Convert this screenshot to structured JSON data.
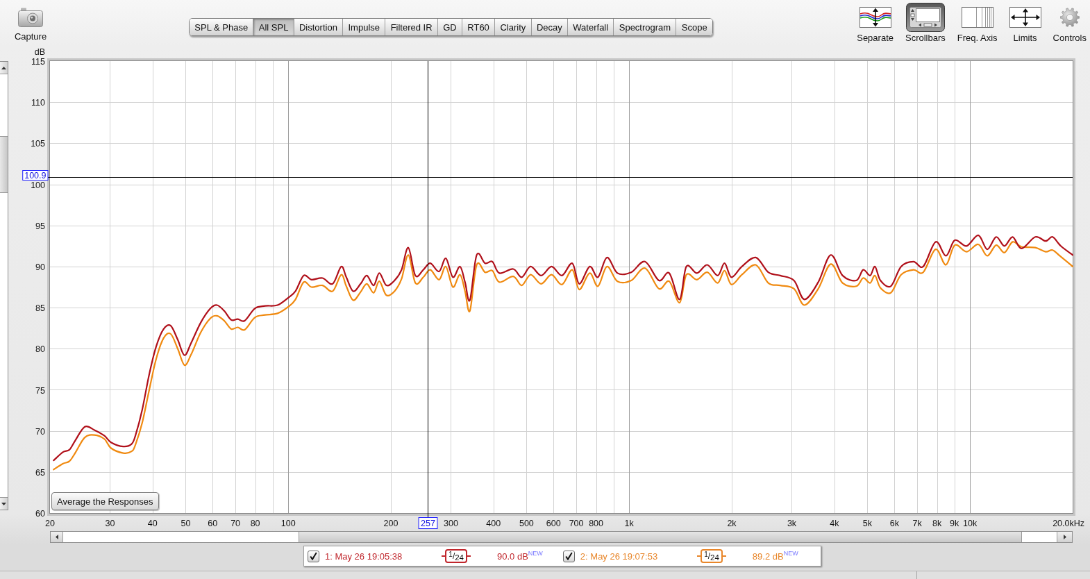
{
  "toolbar": {
    "capture": {
      "label": "Capture"
    },
    "tabs": [
      {
        "label": "SPL & Phase",
        "selected": false
      },
      {
        "label": "All SPL",
        "selected": true
      },
      {
        "label": "Distortion",
        "selected": false
      },
      {
        "label": "Impulse",
        "selected": false
      },
      {
        "label": "Filtered IR",
        "selected": false
      },
      {
        "label": "GD",
        "selected": false
      },
      {
        "label": "RT60",
        "selected": false
      },
      {
        "label": "Clarity",
        "selected": false
      },
      {
        "label": "Decay",
        "selected": false
      },
      {
        "label": "Waterfall",
        "selected": false
      },
      {
        "label": "Spectrogram",
        "selected": false
      },
      {
        "label": "Scope",
        "selected": false
      }
    ],
    "tools": [
      {
        "kind": "separate",
        "label": "Separate",
        "selected": false
      },
      {
        "kind": "scrollbars",
        "label": "Scrollbars",
        "selected": true
      },
      {
        "kind": "axis",
        "label": "Freq. Axis",
        "selected": false
      },
      {
        "kind": "limits",
        "label": "Limits",
        "selected": false
      },
      {
        "kind": "controls",
        "label": "Controls",
        "selected": false
      }
    ]
  },
  "graph": {
    "average_button": "Average the Responses",
    "chart_data": {
      "type": "line",
      "xlabel": "Hz",
      "ylabel": "dB",
      "log": "x",
      "grid": true,
      "xlim": [
        20,
        20000
      ],
      "ylim": [
        60,
        115
      ],
      "xticks": [
        20,
        30,
        40,
        50,
        60,
        70,
        80,
        100,
        200,
        300,
        400,
        500,
        600,
        700,
        800,
        {
          "value": 1000,
          "label": "1k"
        },
        {
          "value": 2000,
          "label": "2k"
        },
        {
          "value": 3000,
          "label": "3k"
        },
        {
          "value": 4000,
          "label": "4k"
        },
        {
          "value": 5000,
          "label": "5k"
        },
        {
          "value": 6000,
          "label": "6k"
        },
        {
          "value": 7000,
          "label": "7k"
        },
        {
          "value": 8000,
          "label": "8k"
        },
        {
          "value": 9000,
          "label": "9k"
        },
        {
          "value": 10000,
          "label": "10k"
        },
        {
          "value": 20000,
          "label": "20.0k"
        }
      ],
      "yticks": [
        60,
        65,
        70,
        75,
        80,
        85,
        90,
        95,
        100,
        105,
        110,
        115
      ],
      "x": [
        20.5,
        21.8,
        22.8,
        23.7,
        25.3,
        27,
        28.9,
        30.2,
        32.8,
        34.7,
        35.6,
        37.3,
        39.1,
        41,
        43.1,
        45.2,
        47.4,
        49.6,
        51.9,
        55.4,
        59.1,
        61.8,
        64.9,
        68,
        71.1,
        74.5,
        79.8,
        85.5,
        93,
        100,
        105,
        111,
        117,
        126,
        135,
        143,
        148,
        155,
        163,
        170,
        178,
        185,
        194,
        205,
        215,
        225,
        236,
        249,
        261,
        277,
        290,
        304,
        319,
        330,
        341,
        357,
        378,
        397,
        416,
        457,
        484,
        514,
        552,
        592,
        635,
        681,
        714,
        766,
        810,
        861,
        924,
        1014,
        1113,
        1223,
        1311,
        1406,
        1472,
        1580,
        1695,
        1818,
        1905,
        1996,
        2142,
        2352,
        2560,
        2774,
        3045,
        3268,
        3587,
        3903,
        4227,
        4637,
        4859,
        5092,
        5262,
        5462,
        5855,
        6277,
        6828,
        7289,
        7925,
        8497,
        9022,
        9769,
        10575,
        11233,
        11931,
        12613,
        13335,
        14160,
        15542,
        16668,
        17465,
        18462,
        20000
      ],
      "series": [
        {
          "color": "#b0101a",
          "values": [
            66.4,
            67.4,
            67.7,
            68.8,
            70.5,
            70.1,
            69.4,
            68.6,
            68.1,
            68.4,
            69.4,
            72.6,
            76.9,
            80.3,
            82.4,
            82.8,
            81.1,
            79.2,
            80.7,
            83.2,
            84.9,
            85.3,
            84.6,
            83.5,
            83.6,
            83.4,
            84.9,
            85.2,
            85.3,
            86.2,
            87.0,
            88.9,
            88.4,
            88.6,
            87.9,
            90.0,
            88.7,
            87.0,
            87.9,
            88.9,
            87.7,
            89.2,
            87.7,
            88.3,
            89.6,
            92.3,
            88.9,
            89.6,
            90.4,
            89.4,
            91.0,
            88.7,
            90.0,
            88.1,
            85.9,
            91.4,
            90.4,
            90.6,
            89.2,
            89.7,
            88.7,
            90.0,
            88.9,
            90.0,
            88.9,
            90.4,
            87.9,
            90.0,
            88.7,
            91.1,
            89.2,
            89.3,
            90.6,
            88.3,
            89.2,
            86.0,
            90.0,
            89.2,
            90.2,
            88.9,
            90.4,
            88.7,
            90.0,
            91.1,
            89.3,
            88.9,
            88.3,
            86.0,
            88.1,
            91.4,
            88.9,
            88.3,
            89.6,
            88.9,
            90.0,
            88.3,
            87.6,
            90.0,
            90.6,
            90.0,
            93.0,
            91.3,
            93.2,
            92.5,
            93.8,
            92.1,
            93.6,
            92.5,
            93.6,
            92.2,
            93.6,
            93.1,
            93.6,
            92.5,
            91.4
          ]
        },
        {
          "color": "#f08a10",
          "values": [
            65.3,
            66.0,
            66.3,
            67.3,
            69.2,
            69.5,
            69.0,
            67.9,
            67.3,
            67.5,
            68.3,
            71.0,
            75.0,
            78.8,
            81.3,
            81.8,
            80.0,
            78.0,
            79.3,
            82.0,
            83.7,
            84.0,
            83.4,
            82.4,
            82.6,
            82.3,
            83.8,
            84.1,
            84.3,
            85.1,
            86.0,
            88.1,
            87.5,
            87.7,
            87.0,
            89.0,
            87.6,
            85.9,
            86.9,
            87.9,
            86.8,
            88.2,
            86.5,
            87.0,
            88.5,
            91.4,
            88.0,
            88.7,
            89.6,
            88.4,
            90.0,
            87.5,
            89.0,
            87.0,
            84.6,
            90.2,
            89.3,
            89.5,
            88.1,
            88.8,
            87.7,
            89.0,
            87.9,
            89.0,
            87.8,
            89.6,
            87.2,
            89.2,
            87.6,
            90.0,
            88.2,
            88.3,
            89.8,
            87.3,
            88.2,
            85.6,
            89.0,
            88.4,
            89.3,
            88.0,
            89.5,
            87.8,
            89.0,
            90.2,
            88.0,
            87.7,
            87.3,
            85.3,
            87.3,
            90.3,
            88.0,
            87.6,
            88.6,
            88.0,
            88.9,
            87.4,
            86.8,
            89.0,
            89.6,
            89.3,
            92.1,
            90.2,
            92.6,
            91.8,
            92.7,
            91.3,
            92.6,
            91.7,
            93.0,
            92.4,
            92.3,
            91.8,
            92.0,
            91.2,
            90.0
          ]
        }
      ],
      "ref_lines": [
        {
          "axis": "y",
          "value": 100.9,
          "label": "100.9",
          "color": "#000000"
        },
        {
          "axis": "x",
          "value": 257,
          "label": "257",
          "color": "#000000"
        }
      ]
    }
  },
  "legend": {
    "items": [
      {
        "checked": true,
        "label": "1: May 26 19:05:38",
        "smoothing": "$^{1}$/$_{24}$",
        "reading": "90.0 dB$^{NEW}$",
        "color": "#c0262c"
      },
      {
        "checked": true,
        "label": "2: May 26 19:07:53",
        "smoothing": "$^{1}$/$_{24}$",
        "reading": "89.2 dB$^{NEW}$",
        "color": "#e8862a"
      }
    ]
  }
}
